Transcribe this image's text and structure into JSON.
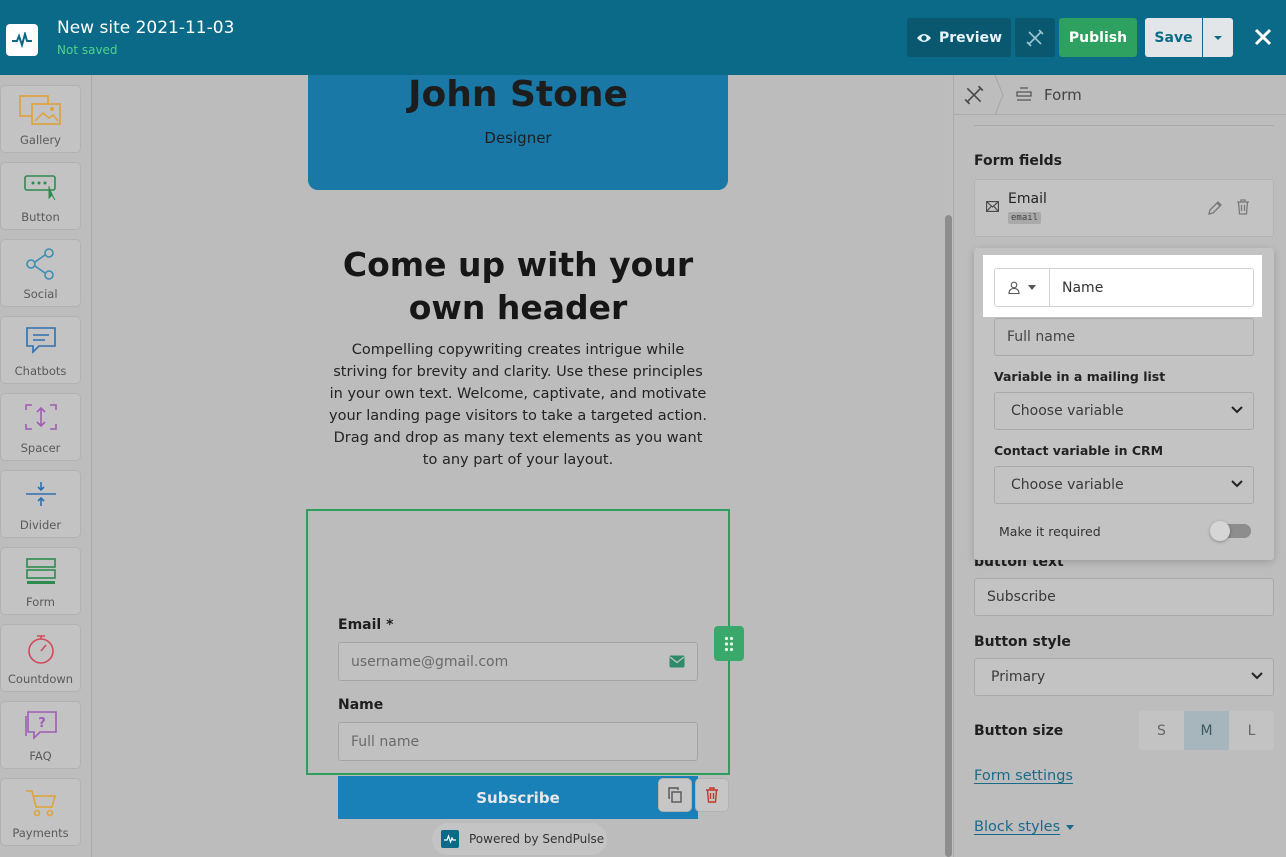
{
  "header": {
    "site_title": "New site 2021-11-03",
    "save_status": "Not saved",
    "preview_label": "Preview",
    "publish_label": "Publish",
    "save_label": "Save"
  },
  "sidebar": {
    "tools": [
      {
        "label": "Gallery"
      },
      {
        "label": "Button"
      },
      {
        "label": "Social"
      },
      {
        "label": "Chatbots"
      },
      {
        "label": "Spacer"
      },
      {
        "label": "Divider"
      },
      {
        "label": "Form"
      },
      {
        "label": "Countdown"
      },
      {
        "label": "FAQ"
      },
      {
        "label": "Payments"
      }
    ]
  },
  "canvas": {
    "hero_name": "John Stone",
    "hero_role": "Designer",
    "headline": "Come up with your own header",
    "body": "Compelling copywriting creates intrigue while striving for brevity and clarity. Use these principles in your own text. Welcome, captivate, and motivate your landing page visitors to take a targeted action. Drag and drop as many text elements as you want to any part of your layout.",
    "form": {
      "email_label": "Email *",
      "email_placeholder": "username@gmail.com",
      "name_label": "Name",
      "name_placeholder": "Full name",
      "submit_label": "Subscribe"
    },
    "powered_by": "Powered by SendPulse"
  },
  "panel": {
    "breadcrumb": "Form",
    "form_fields_heading": "Form fields",
    "field_name": "Email",
    "field_key": "email",
    "button_text_label": "button text",
    "button_text_value": "Subscribe",
    "button_style_label": "Button style",
    "button_style_value": "Primary",
    "button_size_label": "Button size",
    "sizes": [
      "S",
      "M",
      "L"
    ],
    "form_settings_link": "Form settings",
    "block_styles_link": "Block styles"
  },
  "popover": {
    "field_name_value": "Name",
    "placeholder_value": "Full name",
    "mailing_var_label": "Variable in a mailing list",
    "mailing_var_value": "Choose variable",
    "crm_var_label": "Contact variable in CRM",
    "crm_var_value": "Choose variable",
    "required_label": "Make it required",
    "required_on": false
  },
  "colors": {
    "topbar": "#0b6a88",
    "publish": "#2ea05f",
    "form_outline": "#2e9e5e",
    "submit": "#1a80b8"
  }
}
